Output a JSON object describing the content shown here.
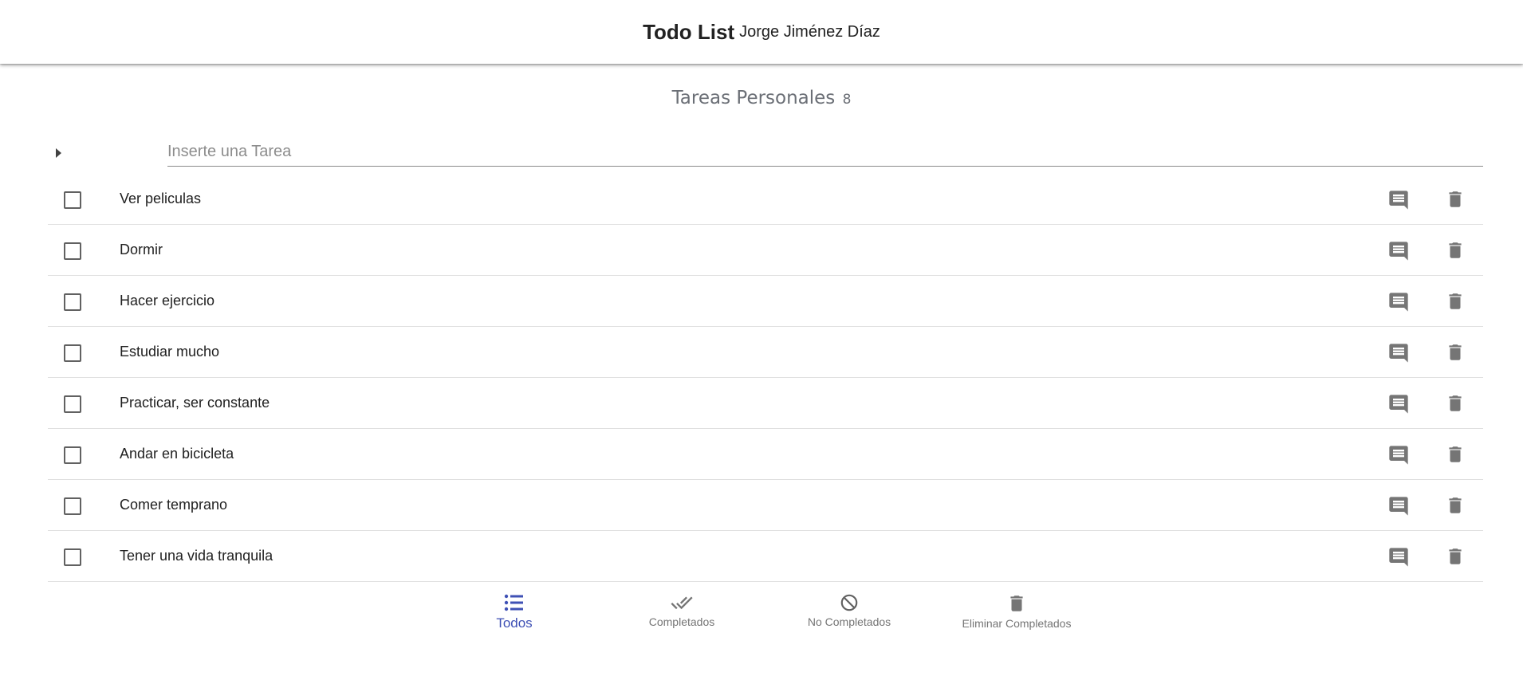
{
  "header": {
    "title": "Todo List",
    "author": "Jorge Jiménez Díaz"
  },
  "section": {
    "title": "Tareas Personales",
    "count": "8"
  },
  "new_task": {
    "placeholder": "Inserte una Tarea",
    "value": ""
  },
  "tasks": [
    {
      "label": "Ver peliculas",
      "completed": false
    },
    {
      "label": "Dormir",
      "completed": false
    },
    {
      "label": "Hacer ejercicio",
      "completed": false
    },
    {
      "label": "Estudiar mucho",
      "completed": false
    },
    {
      "label": "Practicar, ser constante",
      "completed": false
    },
    {
      "label": "Andar en bicicleta",
      "completed": false
    },
    {
      "label": "Comer temprano",
      "completed": false
    },
    {
      "label": "Tener una vida tranquila",
      "completed": false
    }
  ],
  "bottom_nav": {
    "active": "all",
    "all_label": "Todos",
    "completed_label": "Completados",
    "not_completed_label": "No Completados",
    "delete_completed_label": "Eliminar Completados"
  },
  "colors": {
    "accent": "#3f51b5",
    "icon": "#757575",
    "section_title": "#6b6f76",
    "divider": "#e0e0e0"
  },
  "icons": {
    "expand": "arrow-right-icon",
    "comment": "comment-icon",
    "delete": "trash-icon",
    "all": "list-icon",
    "completed": "double-check-icon",
    "not_completed": "block-icon",
    "delete_completed": "trash-icon"
  }
}
